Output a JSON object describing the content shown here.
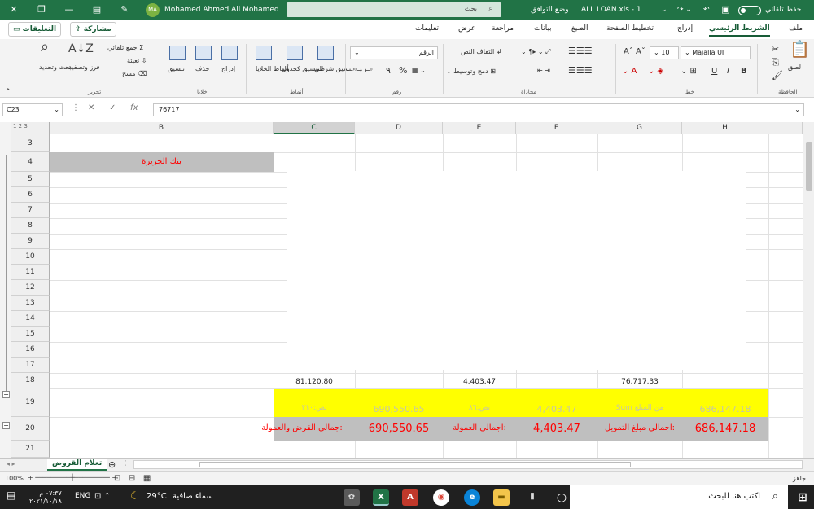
{
  "titlebar": {
    "autosave_label": "حفظ تلقائي",
    "file_name": "ALL LOAN.xls - 1",
    "compat_mode": "وضع التوافق",
    "search_placeholder": "بحث",
    "user_name": "Mohamed  Ahmed Ali Mohamed",
    "user_initials": "MA"
  },
  "tabs": [
    "ملف",
    "الشريط الرئيسي",
    "إدراج",
    "تخطيط الصفحة",
    "الصيغ",
    "بيانات",
    "مراجعة",
    "عرض",
    "تعليمات"
  ],
  "active_tab": "الشريط الرئيسي",
  "share_label": "مشاركة",
  "comments_label": "التعليقات",
  "ribbon": {
    "clipboard": {
      "paste": "لصق",
      "group": "الحافظة"
    },
    "font": {
      "name": "Majalla UI",
      "size": "10",
      "group": "خط",
      "bold": "B",
      "italic": "I",
      "underline": "U"
    },
    "alignment": {
      "wrap": "التفاف النص",
      "merge": "دمج وتوسيط",
      "group": "محاذاة"
    },
    "number": {
      "format": "الرقم",
      "percent": "%",
      "comma": "٩",
      "group": "رقم"
    },
    "styles": {
      "conditional": "تنسيق شرطي",
      "table": "التنسيق كجدول",
      "cell": "أنماط الخلايا",
      "group": "أنماط"
    },
    "cells": {
      "insert": "إدراج",
      "delete": "حذف",
      "format": "تنسيق",
      "group": "خلايا"
    },
    "editing": {
      "autosum": "جمع تلقائي",
      "fill": "تعبئة",
      "clear": "مسح",
      "sort": "فرز وتصفية",
      "find": "بحث وتحديد",
      "group": "تحرير"
    }
  },
  "formula_bar": {
    "name_box": "C23",
    "fx": "fx",
    "value": "76717"
  },
  "columns": [
    "B",
    "C",
    "D",
    "E",
    "F",
    "G",
    "H"
  ],
  "selected_column": "C",
  "rows": [
    "3",
    "4",
    "5",
    "6",
    "7",
    "8",
    "9",
    "10",
    "11",
    "12",
    "13",
    "14",
    "15",
    "16",
    "17",
    "18",
    "19",
    "20",
    "21"
  ],
  "cells": {
    "b4": "بنك الجزيرة",
    "c18": "81,120.80",
    "e18": "4,403.47",
    "g18": "76,717.33",
    "c19": "نص:٢١٠",
    "d19": "690,550.65",
    "e19": "نص:٨٦",
    "f19": "4,403.47",
    "g19": "Sum من المبلغ",
    "h19": "686,147.18",
    "c20": "جمالي القرض والعمولة:",
    "d20": "690,550.65",
    "e20": "اجمالي العمولة:",
    "f20": "4,403.47",
    "g20": "اجمالي مبلغ التمويل:",
    "h20": "686,147.18"
  },
  "sheet_tab": "تعلام القروض",
  "status": {
    "ready": "جاهز",
    "zoom": "100%"
  },
  "taskbar": {
    "search_placeholder": "اكتب هنا للبحث",
    "weather": "سماء صافية",
    "temperature": "29°C",
    "language": "ENG",
    "time": "٠٧:٣٧ م",
    "date": "٢٠٢١/١٠/١٨"
  },
  "colors": {
    "excel_green": "#217346",
    "yellow_fill": "#ffff00",
    "grey_fill": "#bfbfbf",
    "red_text": "#ff0000"
  }
}
